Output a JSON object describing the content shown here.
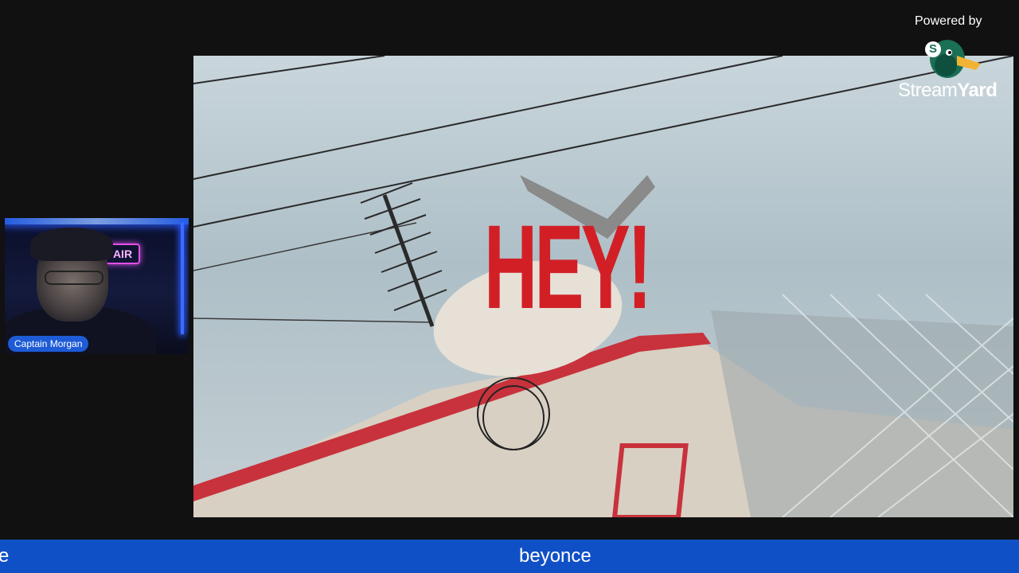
{
  "camera": {
    "participant_name": "Captain Morgan",
    "sign_text": "AIR"
  },
  "main_video": {
    "overlay_text": "HEY!"
  },
  "branding": {
    "powered_by": "Powered by",
    "logo_badge": "S",
    "logo_word_light": "Stream",
    "logo_word_bold": "Yard"
  },
  "ticker": {
    "previous_fragment": "e",
    "current_text": "beyonce"
  },
  "colors": {
    "background": "#111111",
    "ticker": "#1050c7",
    "badge": "#1e5bd6",
    "overlay_red": "#d21f26"
  }
}
